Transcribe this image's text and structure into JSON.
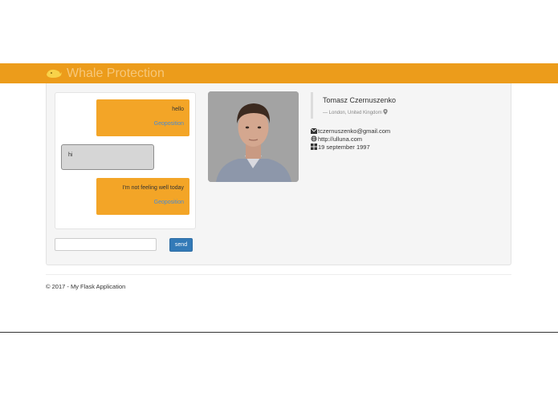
{
  "navbar": {
    "brand": "Whale Protection",
    "brand_icon": "whale-icon",
    "color": "#ec9c1b"
  },
  "chat": {
    "messages": [
      {
        "direction": "outgoing",
        "text": "hello",
        "link": "Geoposition"
      },
      {
        "direction": "incoming",
        "text": "hi"
      },
      {
        "direction": "outgoing",
        "text": "I'm not feeling well today",
        "link": "Geoposition"
      }
    ],
    "input_value": "",
    "send_label": "send"
  },
  "profile": {
    "name": "Tomasz Czernuszenko",
    "location": "— London, United Kingdom",
    "email": "tczernuszenko@gmail.com",
    "website": "http://ulluna.com",
    "birthday": "19 september 1997"
  },
  "footer": {
    "text": "© 2017 - My Flask Application"
  }
}
